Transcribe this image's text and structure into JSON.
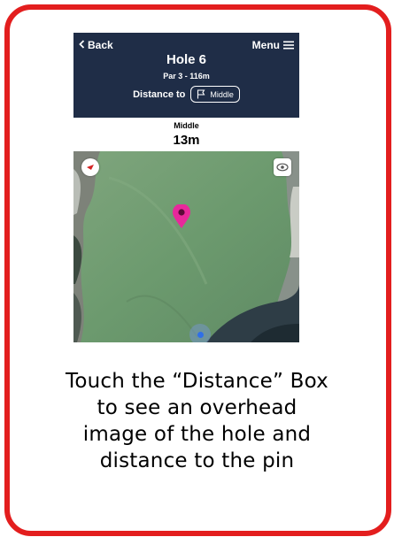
{
  "colors": {
    "frame": "#e31e1e",
    "header_bg": "#1f2d47",
    "pin": "#e8289b",
    "location": "#2f6fe8"
  },
  "header": {
    "back_label": "Back",
    "back_icon": "chevron-left-icon",
    "menu_label": "Menu",
    "menu_icon": "hamburger-icon"
  },
  "hole": {
    "title": "Hole 6",
    "subtitle": "Par 3 - 116m"
  },
  "distance": {
    "label": "Distance to",
    "target_icon": "flag-icon",
    "target": "Middle"
  },
  "info": {
    "label": "Middle",
    "value": "13m"
  },
  "map": {
    "compass_icon": "compass-icon",
    "view_icon": "eye-icon",
    "pin_icon": "map-pin-icon",
    "location_icon": "location-dot-icon"
  },
  "caption": {
    "lines": [
      "Touch the “Distance” Box",
      "to see an overhead",
      "image of the hole and",
      "distance to the pin"
    ]
  }
}
